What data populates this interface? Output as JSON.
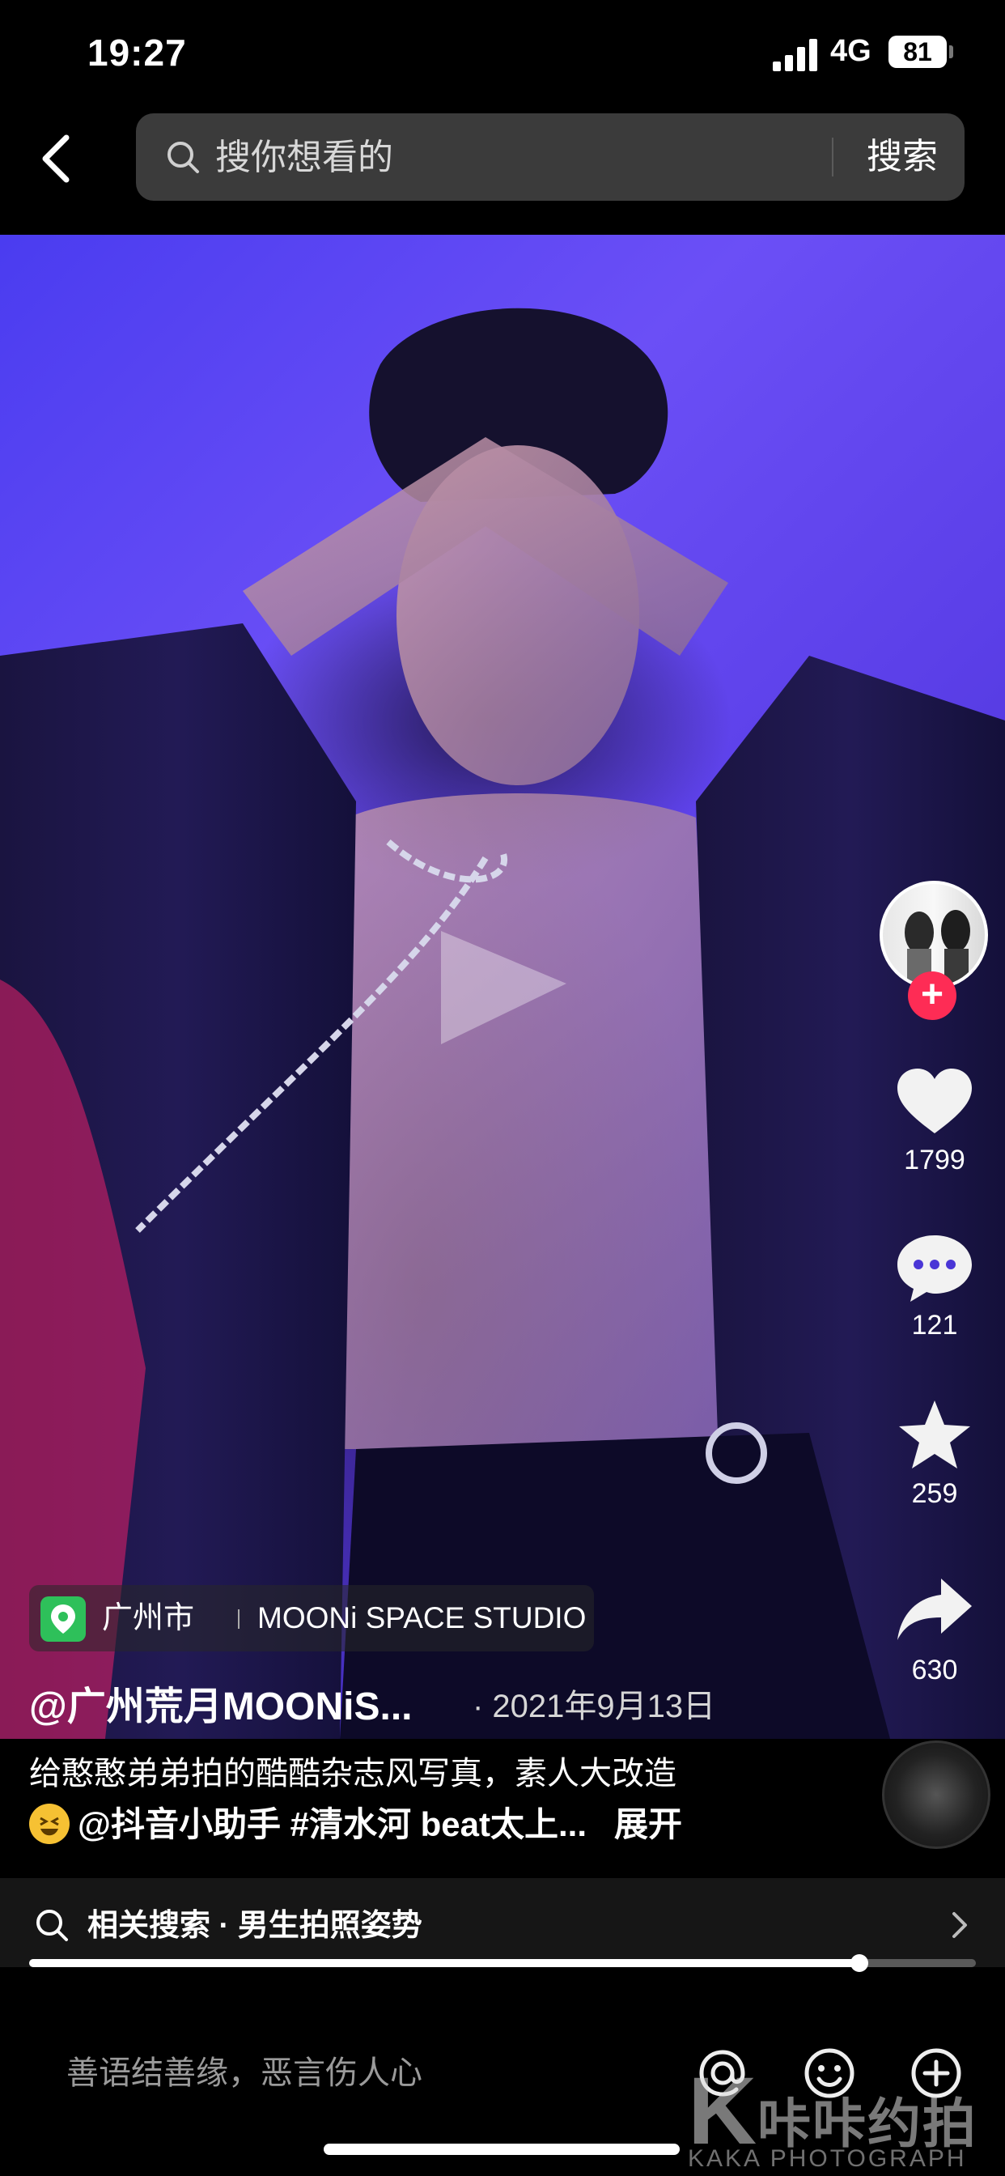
{
  "status_bar": {
    "time": "19:27",
    "network": "4G",
    "battery": "81"
  },
  "search": {
    "placeholder": "搜你想看的",
    "button_label": "搜索"
  },
  "video": {
    "author": "@广州荒月MOONiS...",
    "date": "· 2021年9月13日",
    "location": {
      "city": "广州市",
      "name": "MOONi SPACE STUDIO"
    },
    "caption_line1": "给憨憨弟弟拍的酷酷杂志风写真，素人大改造",
    "caption_line2": "@抖音小助手 #清水河 beat太上...",
    "expand_label": "展开"
  },
  "actions": {
    "likes": "1799",
    "comments": "121",
    "favorites": "259",
    "shares": "630"
  },
  "related_search": {
    "label": "相关搜索 · 男生拍照姿势"
  },
  "progress": {
    "fraction": 0.877
  },
  "comment_bar": {
    "placeholder": "善语结善缘，恶言伤人心"
  },
  "watermark": {
    "logo": "K",
    "name": "咔咔约拍",
    "english": "KAKA  PHOTOGRAPH"
  },
  "colors": {
    "follow": "#fe2c55",
    "location_pin": "#2ec05a",
    "video_bg": "#5b45f0"
  },
  "icons": {
    "back": "chevron-left-icon",
    "like": "heart-icon",
    "comment": "chat-bubble-icon",
    "favorite": "star-icon",
    "share": "share-arrow-icon",
    "play": "play-icon"
  }
}
